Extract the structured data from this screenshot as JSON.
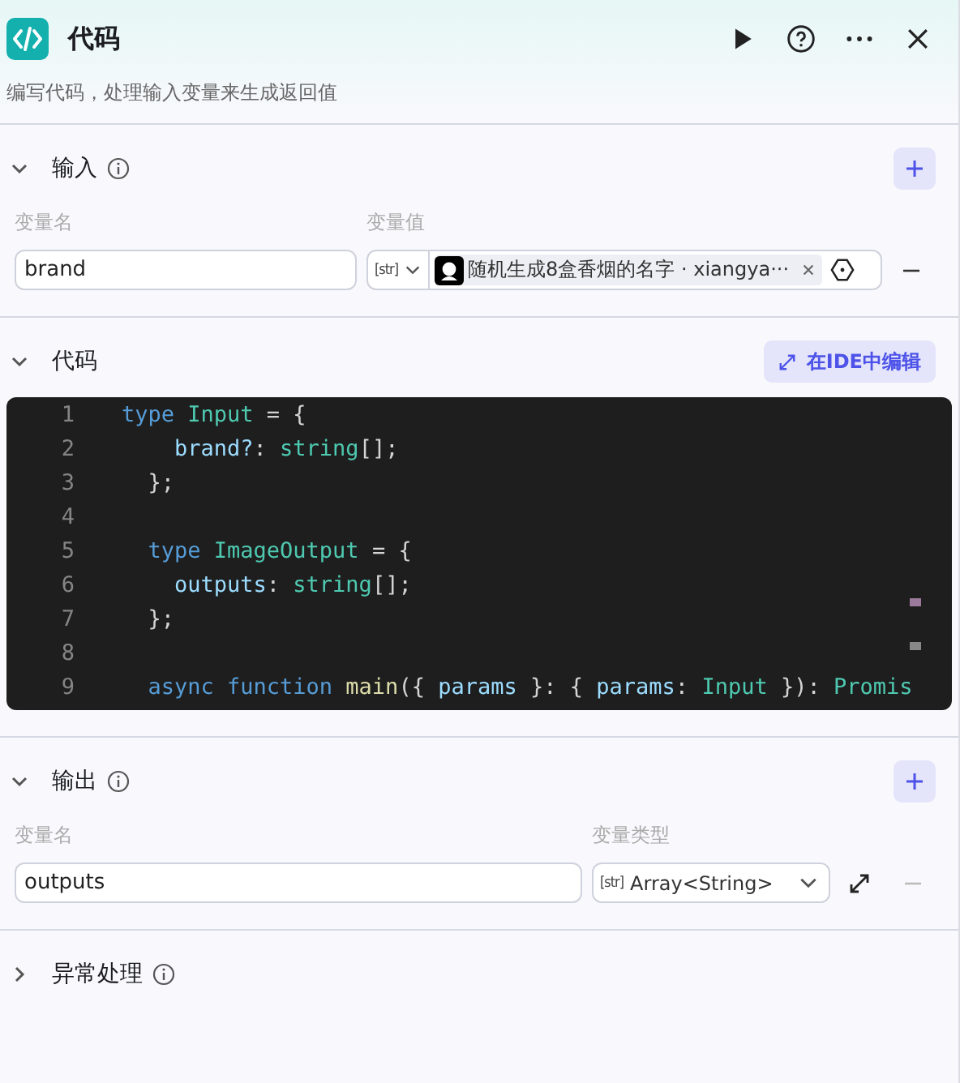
{
  "header": {
    "title": "代码",
    "description": "编写代码，处理输入变量来生成返回值"
  },
  "input": {
    "title": "输入",
    "expanded": true,
    "name_label": "变量名",
    "value_label": "变量值",
    "rows": [
      {
        "name": "brand",
        "type": "[str]",
        "ref": "随机生成8盒香烟的名字 · xiangya···"
      }
    ]
  },
  "code": {
    "title": "代码",
    "expanded": true,
    "ide_button": "在IDE中编辑",
    "lines": [
      {
        "number": "1",
        "tokens": [
          {
            "kind": "keyword",
            "text": "type "
          },
          {
            "kind": "type",
            "text": "Input"
          },
          {
            "kind": "punct",
            "text": " = {"
          }
        ]
      },
      {
        "number": "2",
        "tokens": [
          {
            "kind": "prop",
            "text": "    brand?"
          },
          {
            "kind": "punct",
            "text": ": "
          },
          {
            "kind": "type",
            "text": "string"
          },
          {
            "kind": "punct",
            "text": "[];"
          }
        ]
      },
      {
        "number": "3",
        "tokens": [
          {
            "kind": "punct",
            "text": "  };"
          }
        ]
      },
      {
        "number": "4"
      },
      {
        "number": "5",
        "tokens": [
          {
            "kind": "keyword",
            "text": "  type "
          },
          {
            "kind": "type",
            "text": "ImageOutput"
          },
          {
            "kind": "punct",
            "text": " = {"
          }
        ]
      },
      {
        "number": "6",
        "tokens": [
          {
            "kind": "prop",
            "text": "    outputs"
          },
          {
            "kind": "punct",
            "text": ": "
          },
          {
            "kind": "type",
            "text": "string"
          },
          {
            "kind": "punct",
            "text": "[];"
          }
        ]
      },
      {
        "number": "7",
        "tokens": [
          {
            "kind": "punct",
            "text": "  };"
          }
        ]
      },
      {
        "number": "8"
      },
      {
        "number": "9",
        "tokens": [
          {
            "kind": "keyword",
            "text": "  async function "
          },
          {
            "kind": "func",
            "text": "main"
          },
          {
            "kind": "punct",
            "text": "({ "
          },
          {
            "kind": "prop",
            "text": "params"
          },
          {
            "kind": "punct",
            "text": " }: { "
          },
          {
            "kind": "prop",
            "text": "params"
          },
          {
            "kind": "punct",
            "text": ": "
          },
          {
            "kind": "type",
            "text": "Input"
          },
          {
            "kind": "punct",
            "text": " }): "
          },
          {
            "kind": "type",
            "text": "Promis"
          }
        ]
      }
    ]
  },
  "output": {
    "title": "输出",
    "expanded": true,
    "name_label": "变量名",
    "type_label": "变量类型",
    "rows": [
      {
        "name": "outputs",
        "type_icon": "[str]",
        "type": "Array<String>"
      }
    ]
  },
  "error_handling": {
    "title": "异常处理",
    "expanded": false
  }
}
